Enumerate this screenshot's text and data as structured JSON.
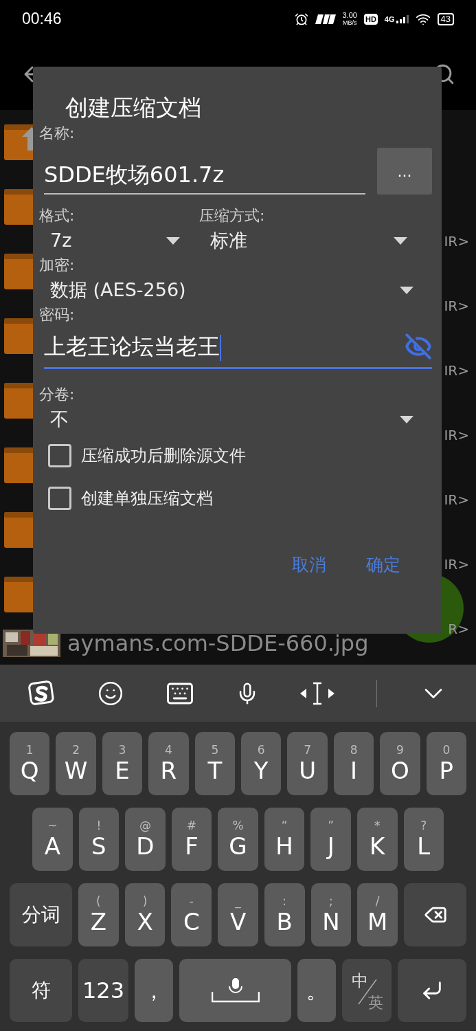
{
  "status_bar": {
    "time": "00:46",
    "speed": "3.00",
    "speed_unit": "MB/s",
    "hd": "HD",
    "network": "4G",
    "battery": "43"
  },
  "file_list": [
    {
      "kind": "up"
    },
    {
      "kind": "folder",
      "tag": "IR>"
    },
    {
      "kind": "folder",
      "tag": "IR>"
    },
    {
      "kind": "folder",
      "tag": "IR>"
    },
    {
      "kind": "folder",
      "tag": "IR>"
    },
    {
      "kind": "folder",
      "tag": "IR>"
    },
    {
      "kind": "folder",
      "tag": "IR>"
    },
    {
      "kind": "folder",
      "tag": "R>"
    },
    {
      "name": "aymans.com-SDDE-660.jpg"
    }
  ],
  "dialog": {
    "title": "创建压缩文档",
    "name_label": "名称:",
    "name_value": "SDDE牧场601.7z",
    "browse_button": "...",
    "format": {
      "label": "格式:",
      "value": "7z"
    },
    "method": {
      "label": "压缩方式:",
      "value": "标准"
    },
    "encryption": {
      "label": "加密:",
      "value": "数据 (AES-256)"
    },
    "password": {
      "label": "密码:",
      "value": "上老王论坛当老王",
      "focused": true,
      "shown": true
    },
    "volumes": {
      "label": "分卷:",
      "value": "不"
    },
    "options": [
      {
        "label": "压缩成功后删除源文件",
        "checked": false
      },
      {
        "label": "创建单独压缩文档",
        "checked": false
      }
    ],
    "buttons": [
      "取消",
      "确定"
    ]
  },
  "keyboard": {
    "rows": [
      {
        "keys": [
          {
            "kind": "letter",
            "label": "Q",
            "hint": "1"
          },
          {
            "kind": "letter",
            "label": "W",
            "hint": "2"
          },
          {
            "kind": "letter",
            "label": "E",
            "hint": "3"
          },
          {
            "kind": "letter",
            "label": "R",
            "hint": "4"
          },
          {
            "kind": "letter",
            "label": "T",
            "hint": "5"
          },
          {
            "kind": "letter",
            "label": "Y",
            "hint": "6"
          },
          {
            "kind": "letter",
            "label": "U",
            "hint": "7"
          },
          {
            "kind": "letter",
            "label": "I",
            "hint": "8"
          },
          {
            "kind": "letter",
            "label": "O",
            "hint": "9"
          },
          {
            "kind": "letter",
            "label": "P",
            "hint": "0"
          }
        ]
      },
      {
        "keys": [
          {
            "kind": "letter",
            "label": "A",
            "hint": "~"
          },
          {
            "kind": "letter",
            "label": "S",
            "hint": "!"
          },
          {
            "kind": "letter",
            "label": "D",
            "hint": "@"
          },
          {
            "kind": "letter",
            "label": "F",
            "hint": "#"
          },
          {
            "kind": "letter",
            "label": "G",
            "hint": "%"
          },
          {
            "kind": "letter",
            "label": "H",
            "hint": "“"
          },
          {
            "kind": "letter",
            "label": "J",
            "hint": "”"
          },
          {
            "kind": "letter",
            "label": "K",
            "hint": "*"
          },
          {
            "kind": "letter",
            "label": "L",
            "hint": "?"
          }
        ]
      },
      {
        "keys": [
          {
            "kind": "wide",
            "label": "分词"
          },
          {
            "kind": "letter",
            "label": "Z",
            "hint": "("
          },
          {
            "kind": "letter",
            "label": "X",
            "hint": ")"
          },
          {
            "kind": "letter",
            "label": "C",
            "hint": "-"
          },
          {
            "kind": "letter",
            "label": "V",
            "hint": "_"
          },
          {
            "kind": "letter",
            "label": "B",
            "hint": ":"
          },
          {
            "kind": "letter",
            "label": "N",
            "hint": ";"
          },
          {
            "kind": "letter",
            "label": "M",
            "hint": "/"
          },
          {
            "kind": "backspace"
          }
        ]
      },
      {
        "keys": [
          {
            "kind": "wide",
            "label": "符"
          },
          {
            "kind": "numbers",
            "label": "123"
          },
          {
            "kind": "punct",
            "label": "，"
          },
          {
            "kind": "space"
          },
          {
            "kind": "punct",
            "label": "。"
          },
          {
            "kind": "lang",
            "label": "中",
            "hint": "英"
          },
          {
            "kind": "enter"
          }
        ]
      }
    ]
  }
}
